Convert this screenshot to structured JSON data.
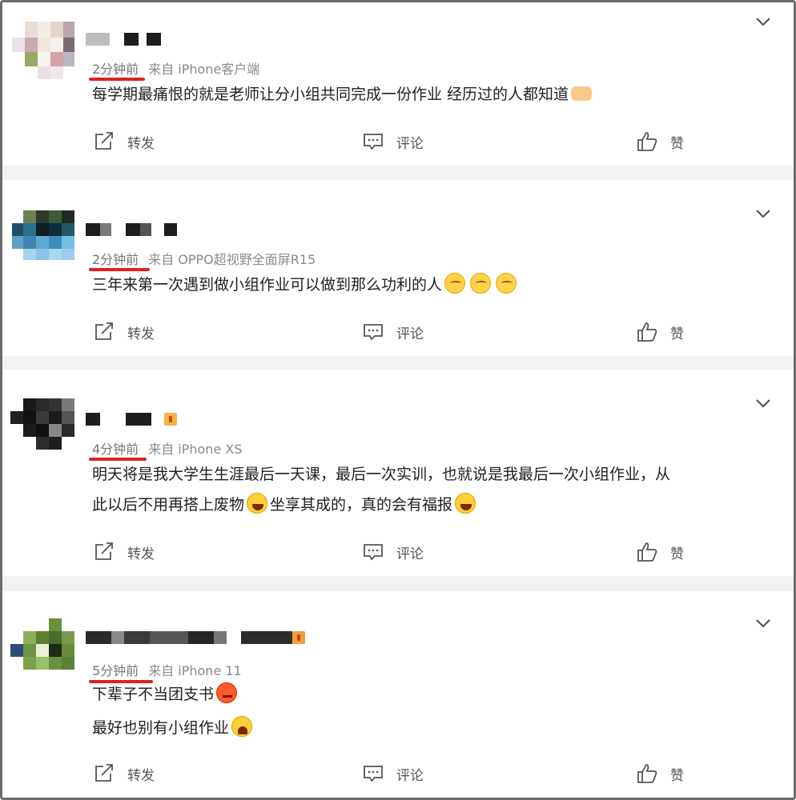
{
  "colors": {
    "background": "#f2f2f2",
    "card": "#ffffff",
    "meta_text": "#8a8a8a",
    "underline": "#e02020",
    "action_text": "#555555"
  },
  "actions": {
    "forward_label": "转发",
    "comment_label": "评论",
    "like_label": "赞"
  },
  "posts": [
    {
      "time": "2分钟前",
      "source": "来自 iPhone客户端",
      "lines": [
        "每学期最痛恨的就是老师让分小组共同完成一份作业 经历过的人都知道"
      ],
      "emoji": [
        "handshake"
      ]
    },
    {
      "time": "2分钟前",
      "source": "来自 OPPO超视野全面屏R15",
      "lines": [
        "三年来第一次遇到做小组作业可以做到那么功利的人"
      ],
      "emoji": [
        "thinking",
        "thinking",
        "thinking"
      ]
    },
    {
      "time": "4分钟前",
      "source": "来自 iPhone XS",
      "lines": [
        "明天将是我大学生生涯最后一天课，最后一次实训，也就说是我最后一次小组作业，从",
        "此以后不用再搭上废物",
        "坐享其成的，真的会有福报"
      ],
      "emoji": [
        "laughing",
        "laughing"
      ]
    },
    {
      "time": "5分钟前",
      "source": "来自 iPhone 11",
      "lines": [
        "下辈子不当团支书",
        "最好也别有小组作业"
      ],
      "emoji": [
        "angry",
        "crying"
      ]
    }
  ]
}
